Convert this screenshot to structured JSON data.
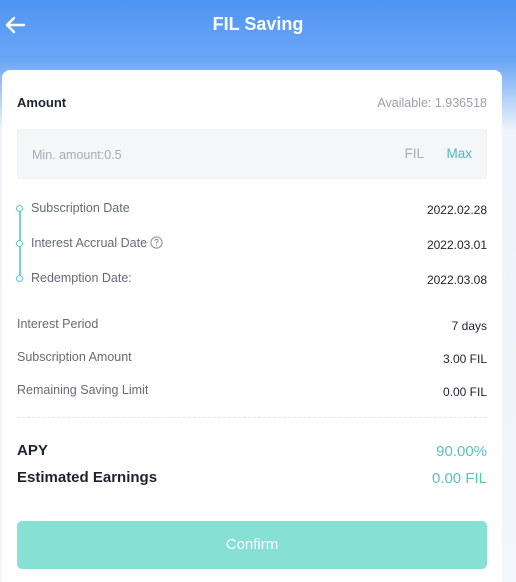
{
  "header": {
    "title": "FIL Saving"
  },
  "amount": {
    "label": "Amount",
    "available": "Available: 1.936518",
    "placeholder": "Min. amount:0.5",
    "unit": "FIL",
    "max_label": "Max"
  },
  "timeline": [
    {
      "label": "Subscription Date",
      "value": "2022.02.28"
    },
    {
      "label": "Interest Accrual Date",
      "value": "2022.03.01"
    },
    {
      "label": "Redemption Date:",
      "value": "2022.03.08"
    }
  ],
  "details": [
    {
      "label": "Interest Period",
      "value": "7 days"
    },
    {
      "label": "Subscription Amount",
      "value": "3.00 FIL"
    },
    {
      "label": "Remaining Saving Limit",
      "value": "0.00 FIL"
    }
  ],
  "summary": {
    "apy_label": "APY",
    "apy_value": "90.00%",
    "earnings_label": "Estimated Earnings",
    "earnings_value": "0.00 FIL"
  },
  "confirm_label": "Confirm",
  "colors": {
    "header_blue": "#4f95f4",
    "accent_teal": "#4ab8c9",
    "green_value": "#58c4b6",
    "confirm_button": "#86e0d4"
  },
  "icons": {
    "back": "arrow-left-icon",
    "help": "question-circle-icon"
  }
}
